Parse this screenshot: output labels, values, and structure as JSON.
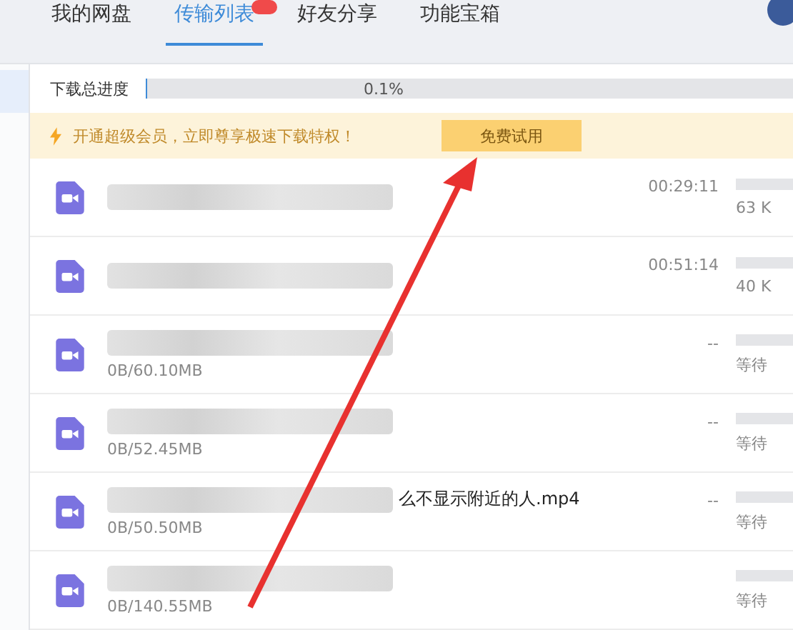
{
  "tabs": [
    {
      "label": "我的网盘",
      "selected": false,
      "badge": false
    },
    {
      "label": "传输列表",
      "selected": true,
      "badge": true
    },
    {
      "label": "好友分享",
      "selected": false,
      "badge": false
    },
    {
      "label": "功能宝箱",
      "selected": false,
      "badge": false
    }
  ],
  "progress": {
    "label": "下载总进度",
    "level": 0.001,
    "reading": "0.1%"
  },
  "promo": {
    "text": "开通超级会员，立即尊享极速下载特权！",
    "button": "免费试用"
  },
  "rows": [
    {
      "name": "",
      "size": "",
      "time": "00:29:11",
      "status": "63 K"
    },
    {
      "name": "",
      "size": "",
      "time": "00:51:14",
      "status": "40 K"
    },
    {
      "name": "",
      "size": "0B/60.10MB",
      "time": "--",
      "status": "等待"
    },
    {
      "name": "",
      "size": "0B/52.45MB",
      "time": "--",
      "status": "等待"
    },
    {
      "name": "么不显示附近的人.mp4",
      "size": "0B/50.50MB",
      "time": "--",
      "status": "等待"
    },
    {
      "name": "",
      "size": "0B/140.55MB",
      "time": "",
      "status": "等待"
    }
  ]
}
